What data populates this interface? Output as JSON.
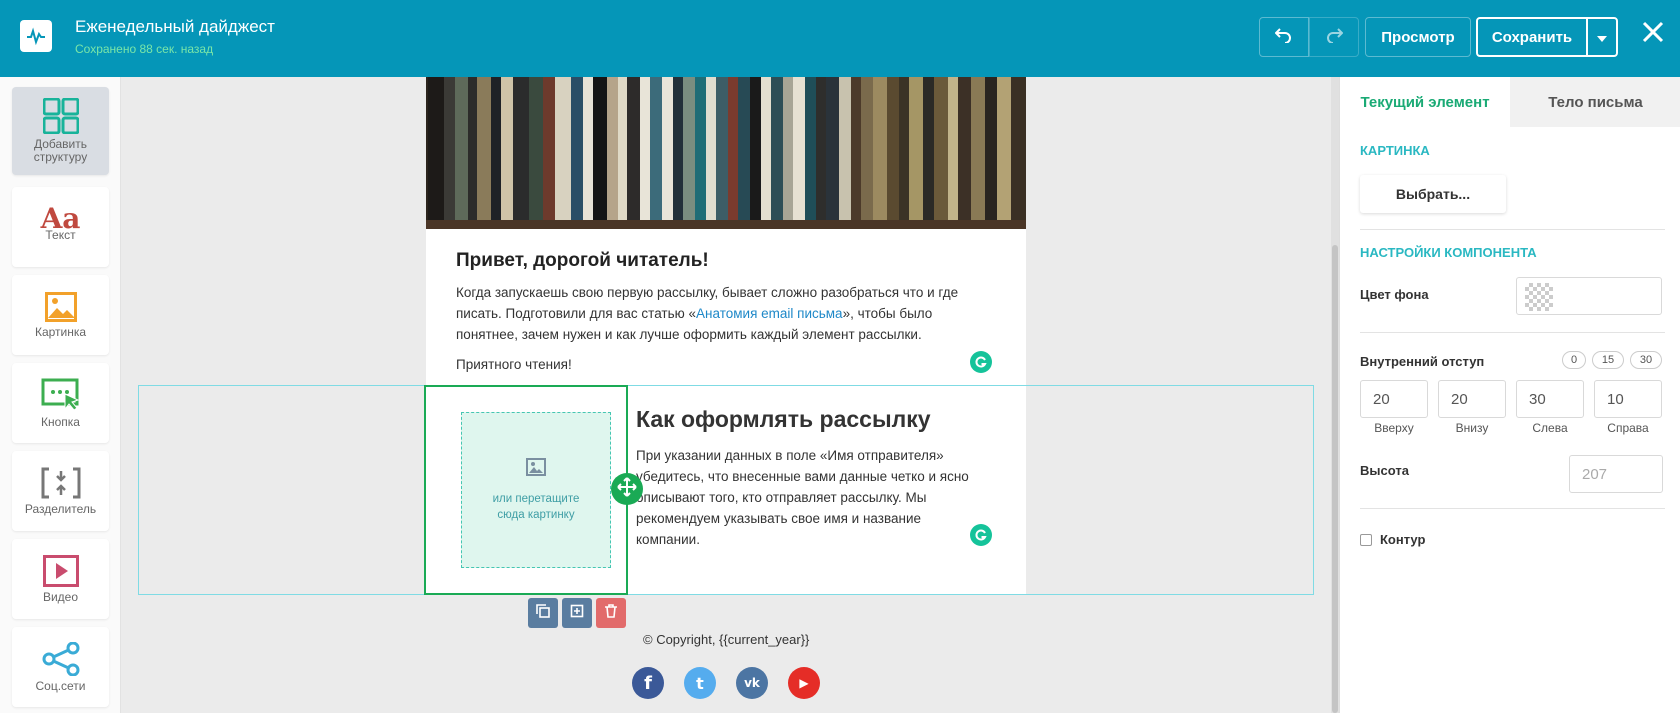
{
  "header": {
    "title": "Еженедельный дайджест",
    "saved_status": "Сохранено 88 сек. назад",
    "preview_label": "Просмотр",
    "save_label": "Сохранить"
  },
  "toolbox": [
    {
      "label": "Добавить структуру",
      "icon": "grid-icon"
    },
    {
      "label": "Текст",
      "icon": "text-icon"
    },
    {
      "label": "Картинка",
      "icon": "image-icon"
    },
    {
      "label": "Кнопка",
      "icon": "button-icon"
    },
    {
      "label": "Разделитель",
      "icon": "divider-icon"
    },
    {
      "label": "Видео",
      "icon": "video-icon"
    },
    {
      "label": "Соц.сети",
      "icon": "share-icon"
    }
  ],
  "email": {
    "greeting_title": "Привет, дорогой читатель!",
    "greeting_text_before_link": "Когда запускаешь свою первую рассылку, бывает сложно разобраться что и где писать. Подготовили для вас статью «",
    "greeting_link": "Анатомия email письма",
    "greeting_text_after_link": "», чтобы было понятнее, зачем нужен и как лучше оформить каждый элемент рассылки.",
    "signoff": "Приятного чтения!",
    "block_title": "Как оформлять рассылку",
    "block_text": "При указании данных в поле «Имя отправителя» убедитесь, что внесенные вами данные четко и ясно описывают того, кто отправляет рассылку. Мы рекомендуем указывать свое имя и название компании.",
    "image_placeholder": "или перетащите сюда картинку",
    "copyright": "© Copyright, {{current_year}}",
    "social": [
      "f",
      "t",
      "vk",
      "▶"
    ]
  },
  "panel": {
    "tab_current": "Текущий элемент",
    "tab_body": "Тело письма",
    "image_section": "КАРТИНКА",
    "choose_label": "Выбрать...",
    "settings_section": "НАСТРОЙКИ КОМПОНЕНТА",
    "bg_color_label": "Цвет фона",
    "padding_label": "Внутренний отступ",
    "presets": [
      "0",
      "15",
      "30"
    ],
    "padding": {
      "top": "20",
      "bottom": "20",
      "left": "30",
      "right": "10"
    },
    "padding_caps": {
      "top": "Вверху",
      "bottom": "Внизу",
      "left": "Слева",
      "right": "Справа"
    },
    "height_label": "Высота",
    "height_placeholder": "207",
    "outline_label": "Контур"
  },
  "colors": {
    "primary": "#0596b8",
    "accent": "#2ab8c2",
    "green": "#1aaa55",
    "saved_text": "#7ae6a8"
  }
}
